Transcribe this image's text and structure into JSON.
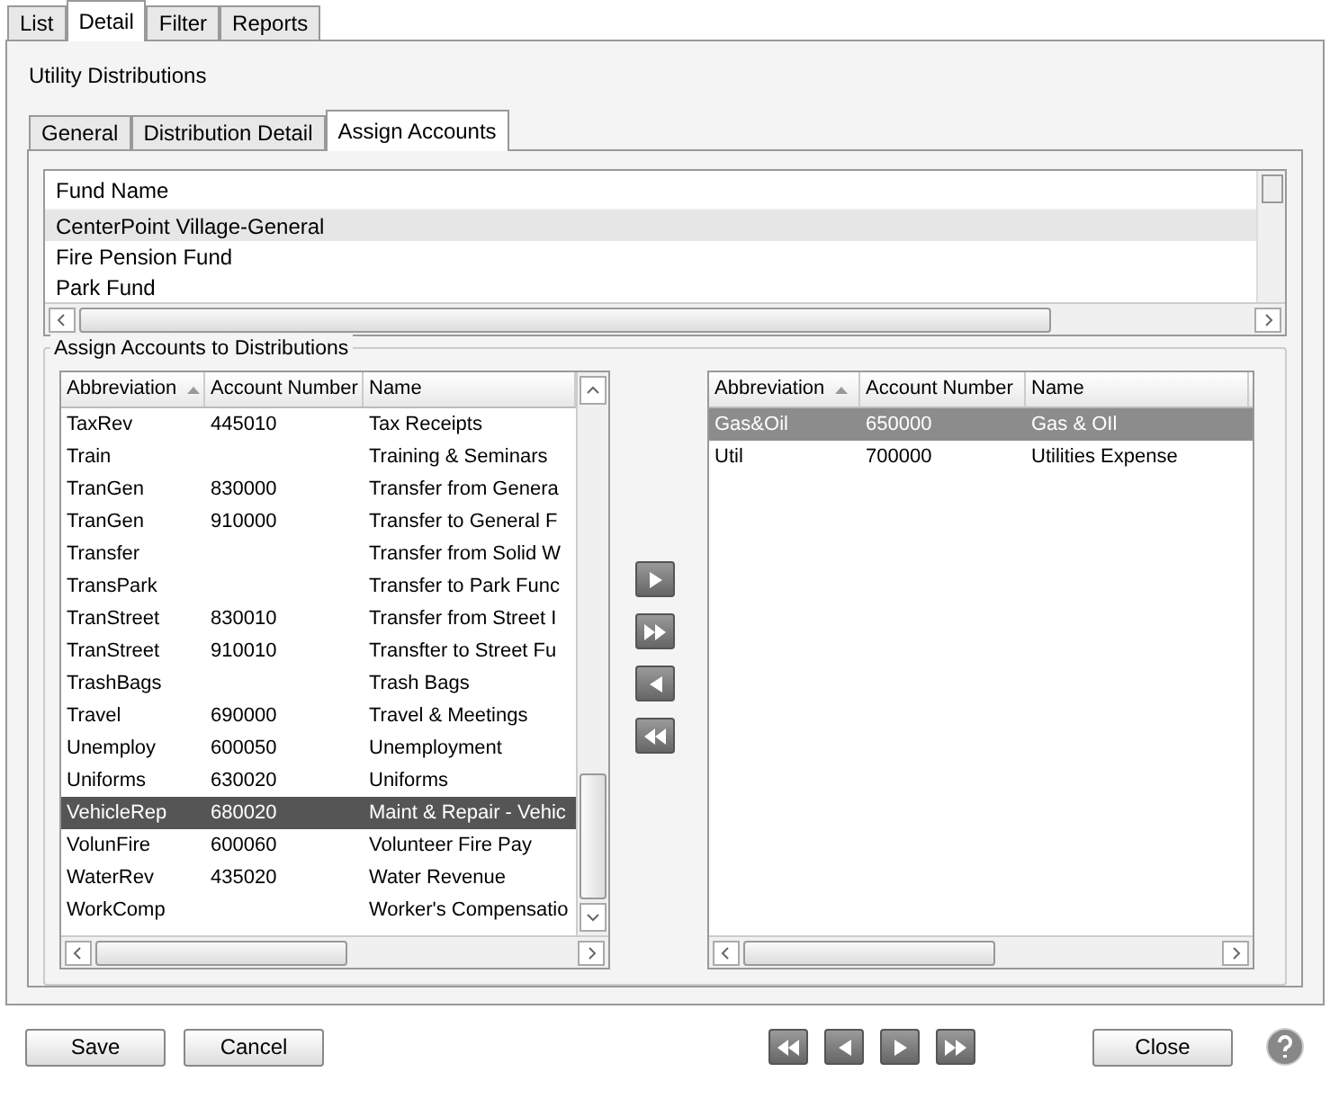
{
  "tabs": [
    {
      "label": "List",
      "selected": false
    },
    {
      "label": "Detail",
      "selected": true
    },
    {
      "label": "Filter",
      "selected": false
    },
    {
      "label": "Reports",
      "selected": false
    }
  ],
  "title": "Utility Distributions",
  "inner_tabs": [
    {
      "label": "General",
      "selected": false
    },
    {
      "label": "Distribution Detail",
      "selected": false
    },
    {
      "label": "Assign Accounts",
      "selected": true
    }
  ],
  "fund_list": {
    "column": "Fund Name",
    "rows": [
      {
        "name": "CenterPoint Village-General",
        "selected": true
      },
      {
        "name": "Fire Pension Fund",
        "selected": false
      },
      {
        "name": "Park Fund",
        "selected": false
      }
    ]
  },
  "group_title": "Assign Accounts to Distributions",
  "available_grid": {
    "columns": [
      {
        "label": "Abbreviation",
        "sorted": true
      },
      {
        "label": "Account Number"
      },
      {
        "label": "Name"
      }
    ],
    "rows": [
      {
        "cells": [
          "TaxRev",
          "445010",
          "Tax Receipts"
        ],
        "selected": false
      },
      {
        "cells": [
          "Train",
          "",
          "Training & Seminars"
        ],
        "selected": false
      },
      {
        "cells": [
          "TranGen",
          "830000",
          "Transfer from Genera"
        ],
        "selected": false
      },
      {
        "cells": [
          "TranGen",
          "910000",
          "Transfer to General F"
        ],
        "selected": false
      },
      {
        "cells": [
          "Transfer",
          "",
          "Transfer from Solid W"
        ],
        "selected": false
      },
      {
        "cells": [
          "TransPark",
          "",
          "Transfer to Park Func"
        ],
        "selected": false
      },
      {
        "cells": [
          "TranStreet",
          "830010",
          "Transfer from Street I"
        ],
        "selected": false
      },
      {
        "cells": [
          "TranStreet",
          "910010",
          "Transfter to Street Fu"
        ],
        "selected": false
      },
      {
        "cells": [
          "TrashBags",
          "",
          "Trash Bags"
        ],
        "selected": false
      },
      {
        "cells": [
          "Travel",
          "690000",
          "Travel & Meetings"
        ],
        "selected": false
      },
      {
        "cells": [
          "Unemploy",
          "600050",
          "Unemployment"
        ],
        "selected": false
      },
      {
        "cells": [
          "Uniforms",
          "630020",
          "Uniforms"
        ],
        "selected": false
      },
      {
        "cells": [
          "VehicleRep",
          "680020",
          "Maint & Repair - Vehic"
        ],
        "selected": true
      },
      {
        "cells": [
          "VolunFire",
          "600060",
          "Volunteer Fire Pay"
        ],
        "selected": false
      },
      {
        "cells": [
          "WaterRev",
          "435020",
          "Water Revenue"
        ],
        "selected": false
      },
      {
        "cells": [
          "WorkComp",
          "",
          "Worker's Compensatio"
        ],
        "selected": false
      }
    ]
  },
  "assigned_grid": {
    "columns": [
      {
        "label": "Abbreviation",
        "sorted": true
      },
      {
        "label": "Account Number"
      },
      {
        "label": "Name"
      }
    ],
    "rows": [
      {
        "cells": [
          "Gas&Oil",
          "650000",
          "Gas & OIl"
        ],
        "selected": true
      },
      {
        "cells": [
          "Util",
          "700000",
          "Utilities Expense"
        ],
        "selected": false
      }
    ]
  },
  "footer_buttons": [
    {
      "label": "Save"
    },
    {
      "label": "Cancel"
    }
  ],
  "close_button": {
    "label": "Close"
  }
}
